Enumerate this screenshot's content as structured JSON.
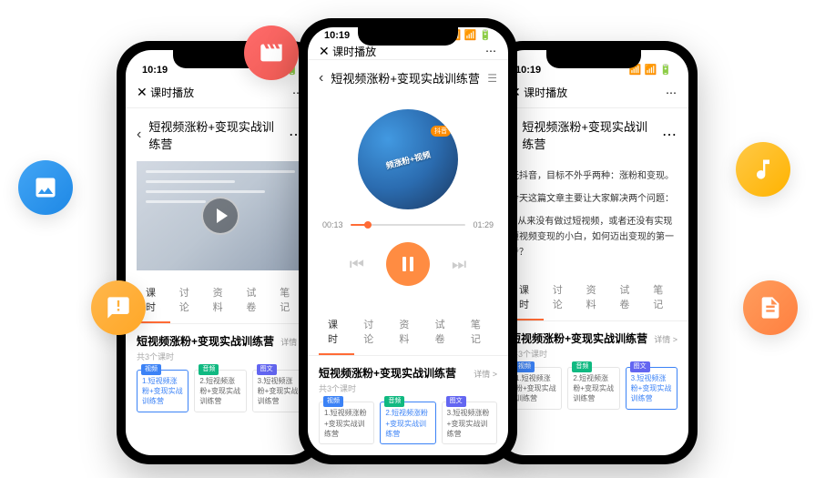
{
  "status_time": "10:19",
  "header_title": "课时播放",
  "close_label": "✕",
  "dots": "⋯",
  "course_title": "短视频涨粉+变现实战训练营",
  "tabs": [
    "课时",
    "讨论",
    "资料",
    "试卷",
    "笔记"
  ],
  "section_title": "短视频涨粉+变现实战训练营",
  "detail_label": "详情 >",
  "lesson_count": "共3个课时",
  "lesson_tags": {
    "video": "视频",
    "audio": "音频",
    "text": "图文"
  },
  "lessons": [
    "1.短视频涨粉+变现实战训练营",
    "2.短视频涨粉+变现实战训练营",
    "3.短视频涨粉+变现实战训练营"
  ],
  "audio": {
    "current": "00:13",
    "total": "01:29",
    "album_text": "频涨粉+视频"
  },
  "article": {
    "p1": "玩抖音，目标不外乎两种：涨粉和变现。",
    "p2": "今天这篇文章主要让大家解决两个问题：",
    "p3": "1.从来没有做过短视频，或者还没有实现短视频变现的小白，如何迈出变现的第一步？"
  }
}
